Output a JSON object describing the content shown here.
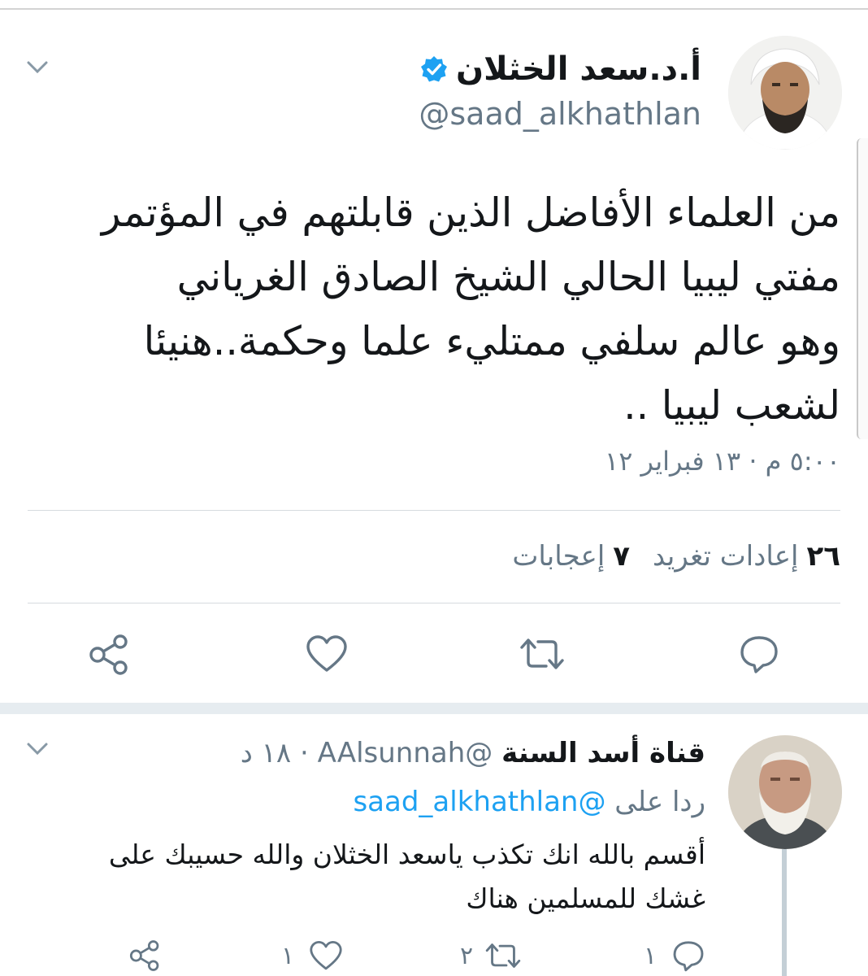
{
  "tweet": {
    "display_name": "أ.د.سعد الخثلان",
    "handle": "@saad_alkhathlan",
    "text_lines": [
      "من العلماء الأفاضل الذين قابلتهم في المؤتمر",
      "مفتي ليبيا الحالي الشيخ الصادق الغرياني",
      "وهو عالم سلفي ممتليء علما وحكمة..هنيئا",
      "لشعب ليبيا .."
    ],
    "timestamp": "٥:٠٠ م · ١٣ فبراير ١٢",
    "retweets_count": "٢٦",
    "retweets_label": "إعادات تغريد",
    "likes_count": "٧",
    "likes_label": "إعجابات",
    "icons": {
      "verified": "verified-badge-icon",
      "reply": "reply-icon",
      "retweet": "retweet-icon",
      "like": "heart-icon",
      "share": "share-icon",
      "menu": "chevron-down-icon"
    },
    "colors": {
      "accent": "#1da1f2",
      "muted": "#657786",
      "text": "#14171a"
    }
  },
  "reply": {
    "display_name": "قناة أسد السنة",
    "handle": "@AAlsunnah",
    "time": "١٨ د",
    "meta_separator": "·",
    "replying_prefix": "ردا على",
    "replying_to": "@saad_alkhathlan",
    "text_lines": [
      "أقسم بالله انك تكذب ياسعد الخثلان والله حسيبك على",
      "غشك للمسلمين هناك"
    ],
    "reply_count": "١",
    "retweet_count": "٢",
    "like_count": "١"
  }
}
